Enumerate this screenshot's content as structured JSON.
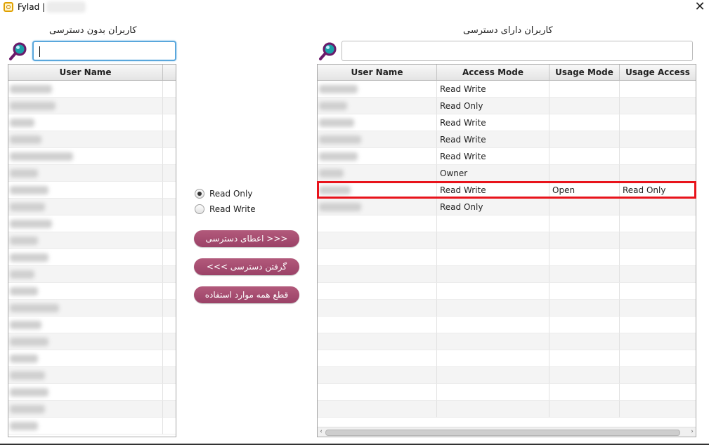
{
  "window": {
    "title": "Fylad |",
    "close_icon": "close-icon"
  },
  "left_panel": {
    "heading": "کاربران بدون دسترسی",
    "search": {
      "placeholder": "",
      "value": ""
    },
    "columns": [
      "User Name"
    ],
    "row_count": 21
  },
  "right_panel": {
    "heading": "کاربران دارای دسترسی",
    "search": {
      "placeholder": "",
      "value": ""
    },
    "columns": [
      "User Name",
      "Access Mode",
      "Usage Mode",
      "Usage Access"
    ],
    "rows": [
      {
        "user": "",
        "access_mode": "Read Write",
        "usage_mode": "",
        "usage_access": ""
      },
      {
        "user": "",
        "access_mode": "Read Only",
        "usage_mode": "",
        "usage_access": ""
      },
      {
        "user": "",
        "access_mode": "Read Write",
        "usage_mode": "",
        "usage_access": ""
      },
      {
        "user": "",
        "access_mode": "Read Write",
        "usage_mode": "",
        "usage_access": ""
      },
      {
        "user": "",
        "access_mode": "Read Write",
        "usage_mode": "",
        "usage_access": ""
      },
      {
        "user": "",
        "access_mode": "Owner",
        "usage_mode": "",
        "usage_access": ""
      },
      {
        "user": "",
        "access_mode": "Read Write",
        "usage_mode": "Open",
        "usage_access": "Read Only"
      },
      {
        "user": "",
        "access_mode": "Read Only",
        "usage_mode": "",
        "usage_access": ""
      }
    ],
    "empty_rows": 12
  },
  "middle": {
    "radio_read_only": "Read Only",
    "radio_read_write": "Read Write",
    "selected": "Read Only",
    "grant_button": "<<< اعطای دسترسی",
    "revoke_button": "گرفتن دسترسی >>>",
    "disconnect_button": "قطع همه موارد استفاده"
  },
  "colors": {
    "button": "#a34a6f",
    "highlight": "#e8131b",
    "focus": "#5aa7dc"
  }
}
